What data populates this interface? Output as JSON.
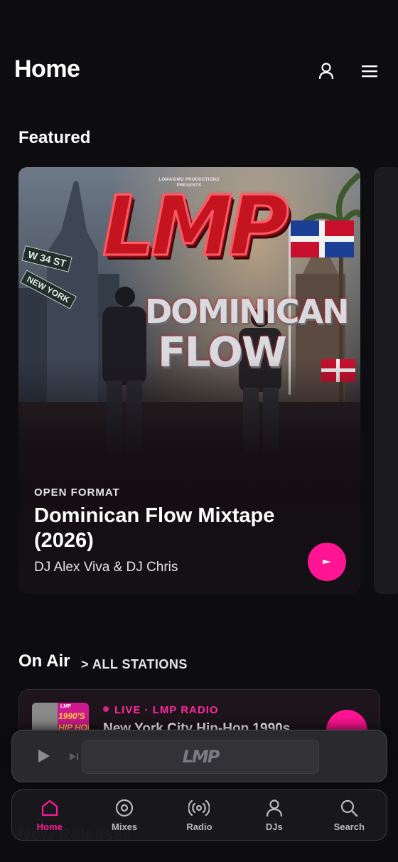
{
  "header": {
    "title": "Home",
    "profile_icon": "user-icon",
    "menu_icon": "hamburger-menu-icon"
  },
  "featured": {
    "section_title": "Featured",
    "card": {
      "artwork": {
        "presents_line1": "LOMAXIMO PRODUCTIONS",
        "presents_line2": "PRESENTS",
        "logo": "LMP",
        "line1": "DOMINICAN",
        "line2": "FLOW",
        "sign1": "W 34 ST",
        "sign2": "NEW YORK"
      },
      "category": "OPEN FORMAT",
      "title": "Dominican Flow Mixtape (2026)",
      "artist": "DJ Alex Viva & DJ Chris"
    }
  },
  "on_air": {
    "section_title": "On Air",
    "link": "> ALL STATIONS",
    "station": {
      "thumb_text1": "LMP",
      "thumb_text2": "1990'S",
      "thumb_text3": "HIP HOP",
      "live_label": "LIVE · LMP RADIO",
      "name": "New York City Hip-Hop 1990s"
    }
  },
  "mini_player": {
    "logo": "LMP"
  },
  "hidden_section": {
    "title": "New Releases"
  },
  "nav": {
    "items": [
      {
        "label": "Home",
        "icon": "home-icon",
        "active": true
      },
      {
        "label": "Mixes",
        "icon": "disc-icon",
        "active": false
      },
      {
        "label": "Radio",
        "icon": "radio-broadcast-icon",
        "active": false
      },
      {
        "label": "DJs",
        "icon": "user-icon",
        "active": false
      },
      {
        "label": "Search",
        "icon": "search-icon",
        "active": false
      }
    ]
  },
  "colors": {
    "background": "#0d0d0f",
    "accent": "#ff1493",
    "card": "#1d151b"
  }
}
